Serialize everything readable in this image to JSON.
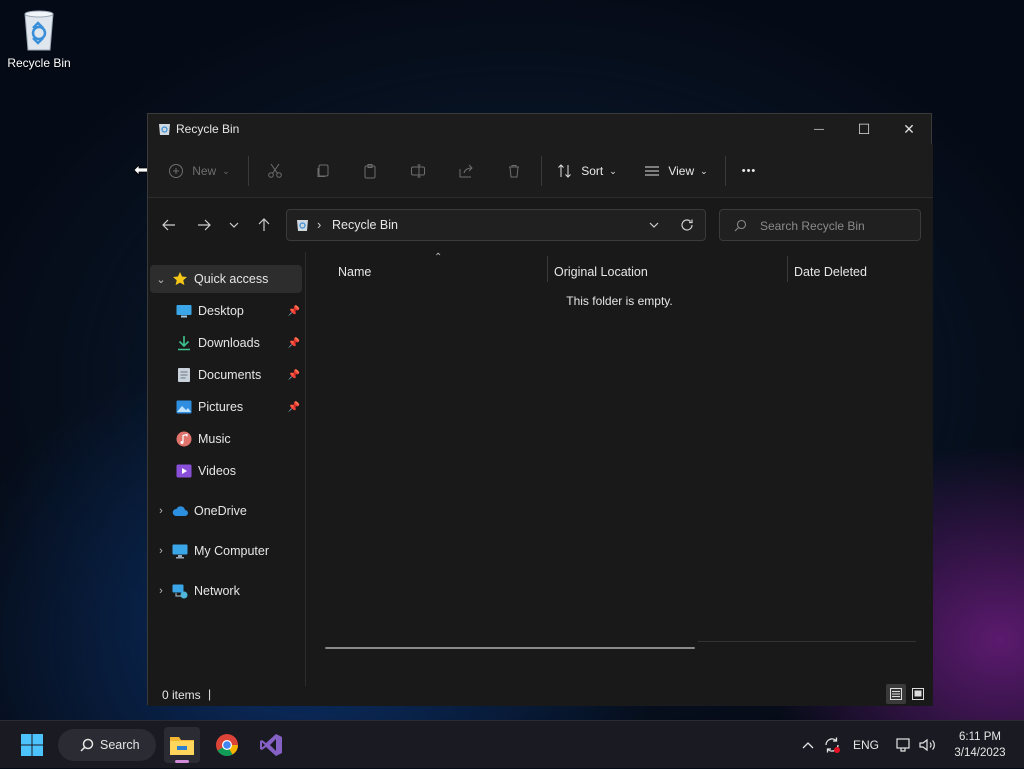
{
  "desktop": {
    "icons": [
      {
        "label": "Recycle Bin"
      }
    ]
  },
  "window": {
    "title": "Recycle Bin",
    "controls": {
      "minimize": "—",
      "maximize": "☐",
      "close": "✕"
    },
    "toolbar": {
      "new_label": "New",
      "sort_label": "Sort",
      "view_label": "View",
      "more_label": "•••"
    },
    "address": {
      "path": "Recycle Bin",
      "separator": "›"
    },
    "search": {
      "placeholder": "Search Recycle Bin"
    },
    "sidebar": {
      "quick_access": {
        "label": "Quick access"
      },
      "items": [
        {
          "label": "Desktop",
          "pinned": true
        },
        {
          "label": "Downloads",
          "pinned": true
        },
        {
          "label": "Documents",
          "pinned": true
        },
        {
          "label": "Pictures",
          "pinned": true
        },
        {
          "label": "Music",
          "pinned": false
        },
        {
          "label": "Videos",
          "pinned": false
        }
      ],
      "roots": [
        {
          "label": "OneDrive"
        },
        {
          "label": "My Computer"
        },
        {
          "label": "Network"
        }
      ]
    },
    "content": {
      "columns": [
        {
          "label": "Name"
        },
        {
          "label": "Original Location"
        },
        {
          "label": "Date Deleted"
        }
      ],
      "empty_message": "This folder is empty."
    },
    "status": {
      "count": "0 items",
      "cursor": "|"
    }
  },
  "taskbar": {
    "search_label": "Search",
    "tray": {
      "language": "ENG",
      "time": "6:11 PM",
      "date": "3/14/2023"
    }
  },
  "colors": {
    "accent": "#0078d4",
    "window_bg": "#1c1c1c",
    "taskbar_bg": "#1a1b22"
  }
}
